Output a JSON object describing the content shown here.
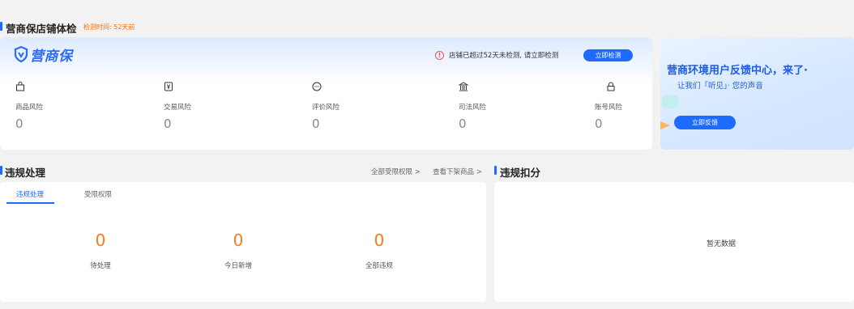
{
  "header": {
    "title": "营商保店铺体检",
    "check_time": "检测时间: 52天前"
  },
  "main_card": {
    "logo_text": "营商保",
    "alert_text": "店铺已超过52天未检测, 请立即检测",
    "check_button": "立即检测",
    "risks": [
      {
        "icon": "bag-icon",
        "label": "商品风险",
        "value": "0"
      },
      {
        "icon": "yen-receipt-icon",
        "label": "交易风险",
        "value": "0"
      },
      {
        "icon": "comment-icon",
        "label": "评价风险",
        "value": "0"
      },
      {
        "icon": "court-icon",
        "label": "司法风险",
        "value": "0"
      },
      {
        "icon": "lock-icon",
        "label": "账号风险",
        "value": "0"
      }
    ]
  },
  "promo": {
    "title": "营商环境用户反馈中心，来了·",
    "subtitle": "让我们「听见」· 您的声音",
    "button": "立即反馈"
  },
  "violation": {
    "title": "违规处理",
    "link_all_restrictions": "全部受限权限 >",
    "link_view_removed": "查看下架商品 >",
    "tabs": [
      {
        "label": "违规处理",
        "active": true
      },
      {
        "label": "受限权限",
        "active": false
      }
    ],
    "stats": [
      {
        "value": "0",
        "label": "待处理"
      },
      {
        "value": "0",
        "label": "今日新增"
      },
      {
        "value": "0",
        "label": "全部违规"
      }
    ]
  },
  "score": {
    "title": "违规扣分",
    "empty_text": "暂无数据"
  },
  "colors": {
    "accent": "#1e6bff",
    "warning": "#ff6a00",
    "stat_orange": "#ff7a1a"
  }
}
